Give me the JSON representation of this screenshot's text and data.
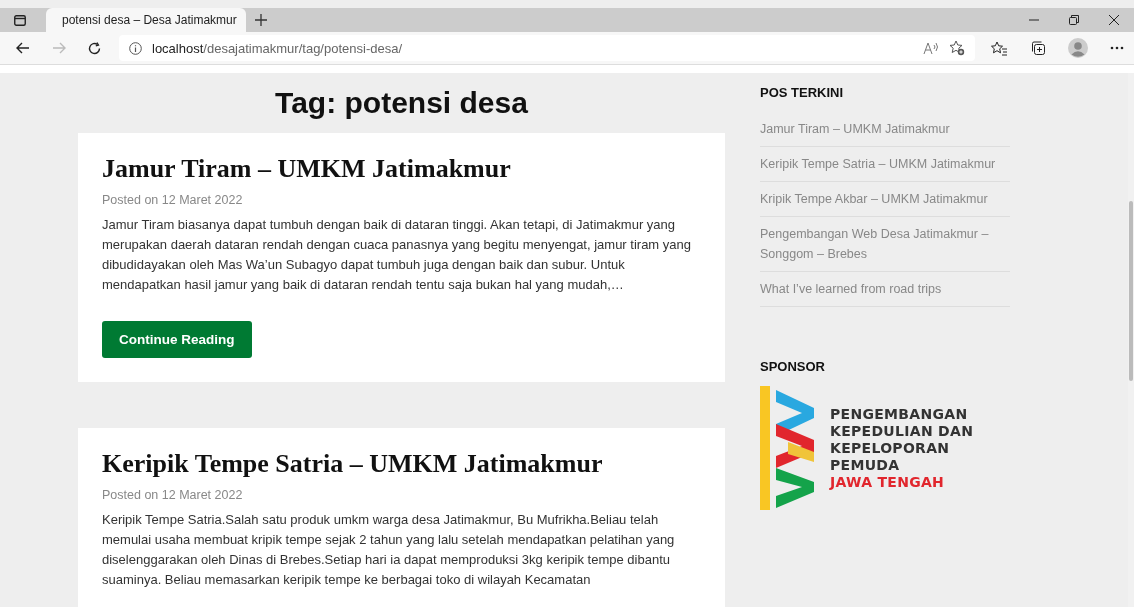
{
  "browser": {
    "tab_title": "potensi desa – Desa Jatimakmur",
    "url_host": "localhost",
    "url_path": "/desajatimakmur/tag/potensi-desa/"
  },
  "page_title": "Tag: potensi desa",
  "posts": [
    {
      "title": "Jamur Tiram – UMKM Jatimakmur",
      "meta": "Posted on 12 Maret 2022",
      "excerpt": "Jamur Tiram biasanya dapat tumbuh dengan baik di dataran tinggi. Akan tetapi, di Jatimakmur yang merupakan daerah dataran rendah dengan cuaca panasnya yang begitu menyengat, jamur tiram yang dibudidayakan oleh Mas Wa’un Subagyo dapat tumbuh juga dengan baik dan subur. Untuk mendapatkan hasil jamur yang baik di dataran rendah tentu saja bukan hal yang mudah,…",
      "button": "Continue Reading"
    },
    {
      "title": "Keripik Tempe Satria – UMKM Jatimakmur",
      "meta": "Posted on 12 Maret 2022",
      "excerpt": "Keripik Tempe Satria.Salah satu produk umkm warga desa Jatimakmur, Bu Mufrikha.Beliau telah memulai usaha membuat kripik tempe sejak 2 tahun yang lalu setelah mendapatkan pelatihan yang diselenggarakan oleh Dinas di Brebes.Setiap hari ia dapat memproduksi 3kg keripik tempe dibantu suaminya. Beliau memasarkan keripik tempe ke berbagai toko di wilayah Kecamatan"
    }
  ],
  "sidebar": {
    "recent_title": "POS TERKINI",
    "recent_posts": [
      "Jamur Tiram – UMKM Jatimakmur",
      "Keripik Tempe Satria – UMKM Jatimakmur",
      "Kripik Tempe Akbar – UMKM Jatimakmur",
      "Pengembangan Web Desa Jatimakmur – Songgom – Brebes",
      "What I’ve learned from road trips"
    ],
    "sponsor_title": "SPONSOR",
    "sponsor_lines": [
      "PENGEMBANGAN",
      "KEPEDULIAN DAN",
      "KEPELOPORAN",
      "PEMUDA"
    ],
    "sponsor_highlight": "JAWA TENGAH"
  }
}
